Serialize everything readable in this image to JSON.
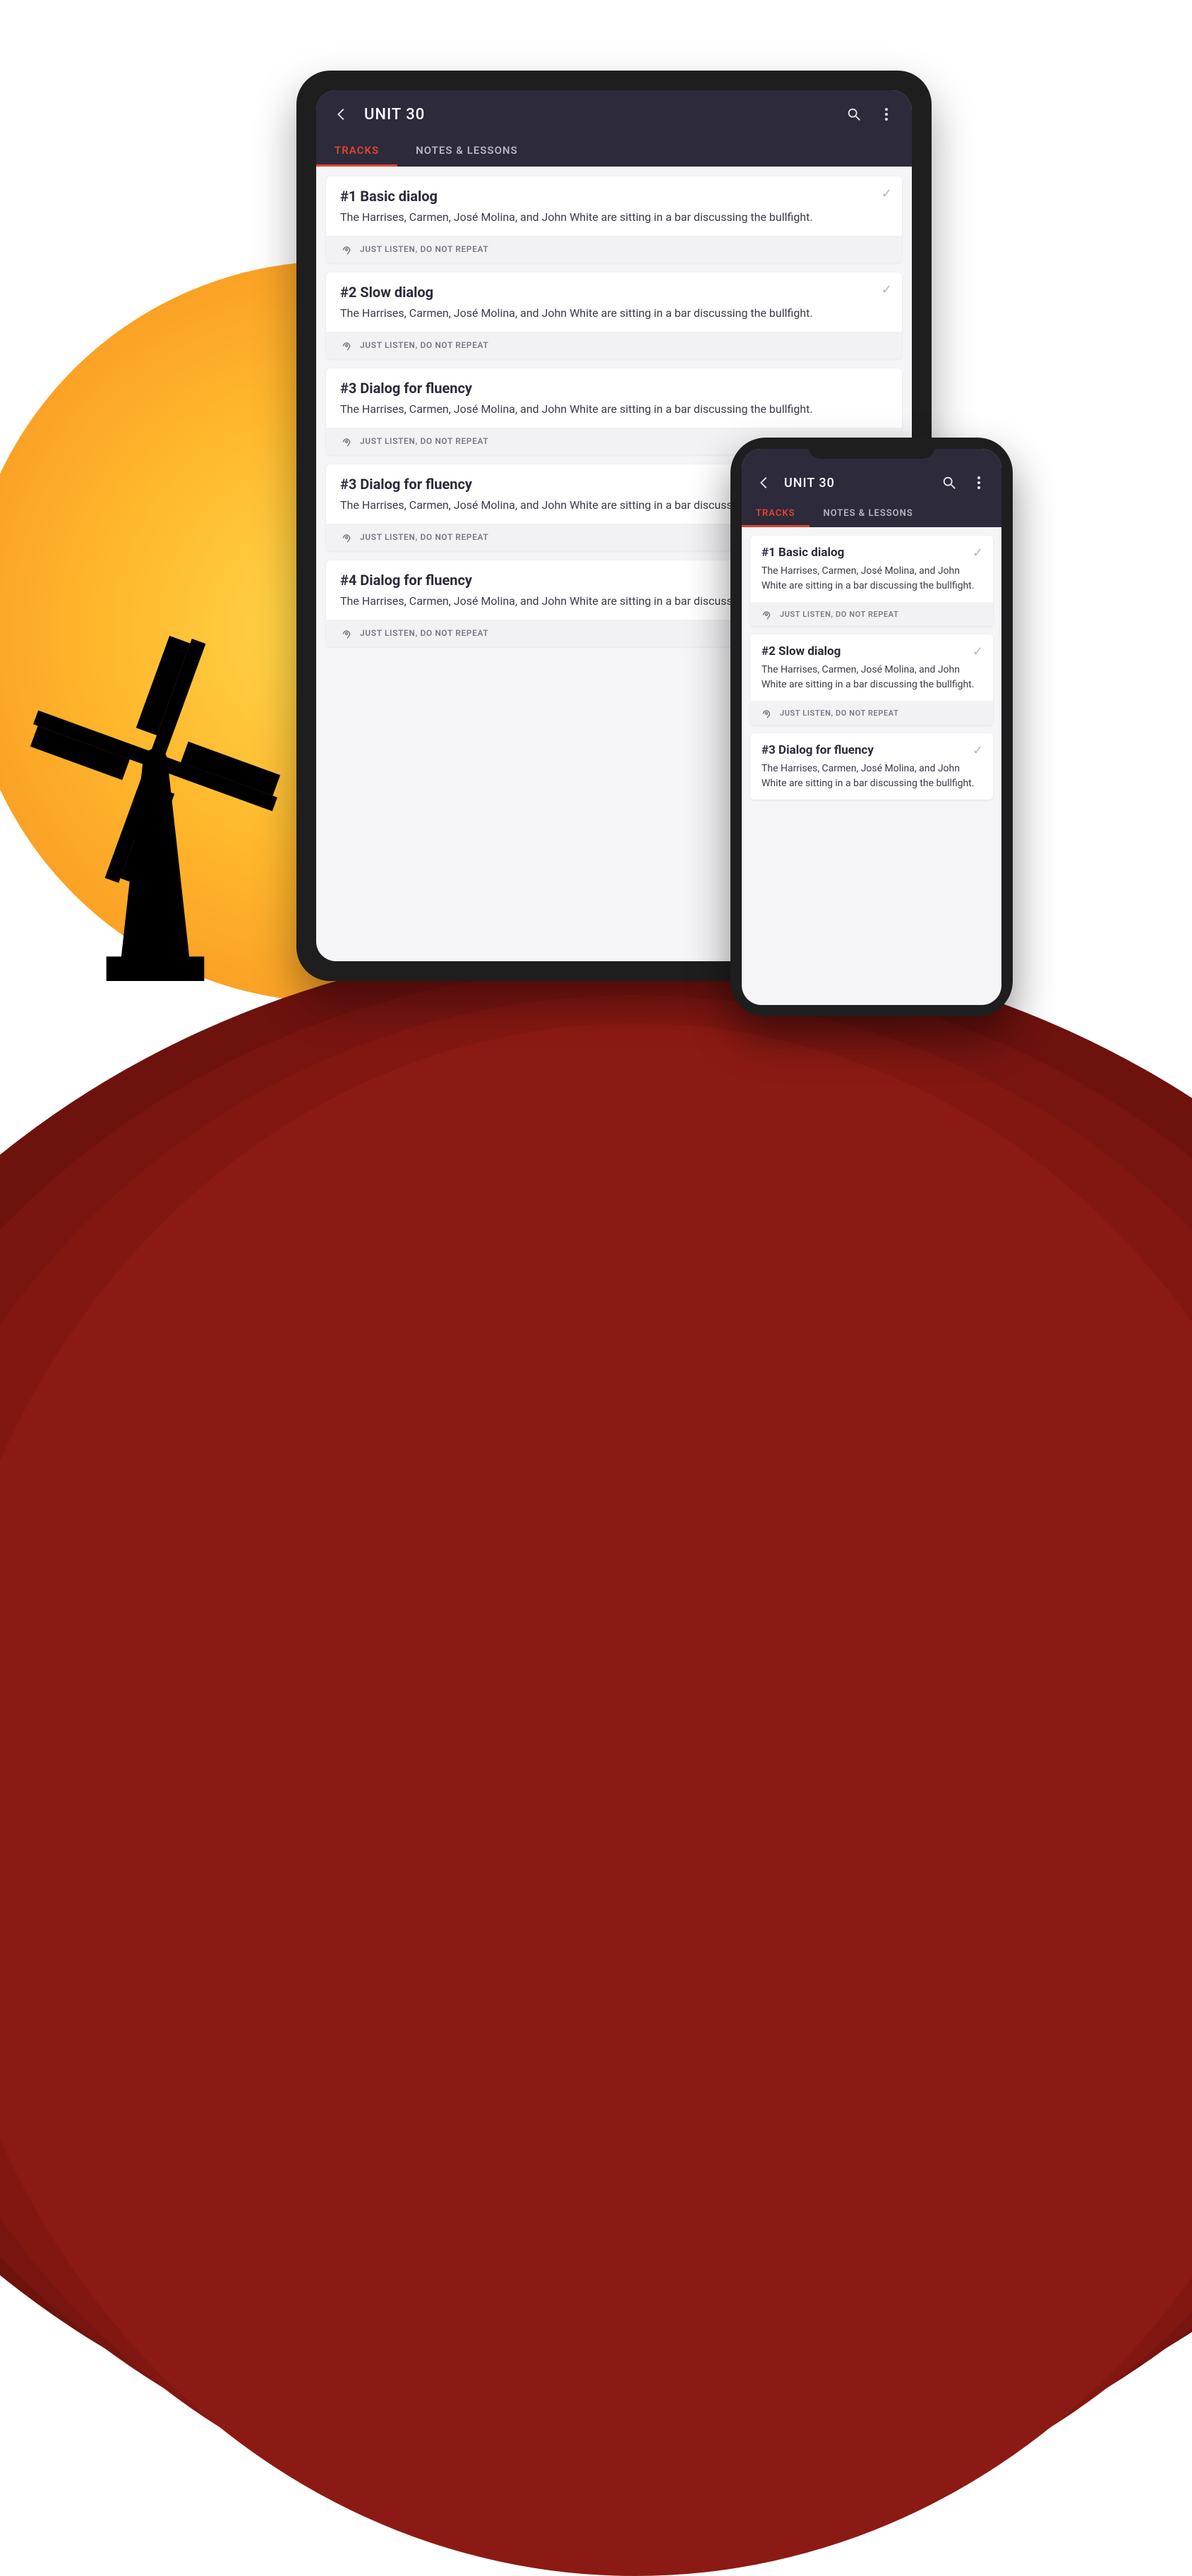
{
  "header": {
    "title": "UNIT 30"
  },
  "tabs": {
    "tracks": "TRACKS",
    "notes": "NOTES & LESSONS"
  },
  "footer_hint": "JUST LISTEN, DO NOT REPEAT",
  "tablet_tracks": [
    {
      "title": "#1 Basic dialog",
      "desc": "The Harrises, Carmen, José Molina, and John White are sitting in a bar discussing the bullfight."
    },
    {
      "title": "#2 Slow dialog",
      "desc": "The Harrises, Carmen, José Molina, and John White are sitting in a bar discussing the bullfight."
    },
    {
      "title": "#3 Dialog for fluency",
      "desc": "The Harrises, Carmen, José Molina, and John White are sitting in a bar discussing the bullfight."
    },
    {
      "title": "#3 Dialog for fluency",
      "desc": "The Harrises, Carmen, José Molina, and John White are sitting in a bar discussing the bullfight."
    },
    {
      "title": "#4 Dialog for fluency",
      "desc": "The Harrises, Carmen, José Molina, and John White are sitting in a bar discussing the bullfight."
    }
  ],
  "phone_tracks": [
    {
      "title": "#1 Basic dialog",
      "desc": "The Harrises, Carmen, José Molina, and John White are sitting in a bar discussing the bullfight."
    },
    {
      "title": "#2 Slow dialog",
      "desc": "The Harrises, Carmen, José Molina, and John White are sitting in a bar discussing the bullfight."
    },
    {
      "title": "#3 Dialog for fluency",
      "desc": "The Harrises, Carmen, José Molina, and John White are sitting in a bar discussing the bullfight."
    }
  ]
}
